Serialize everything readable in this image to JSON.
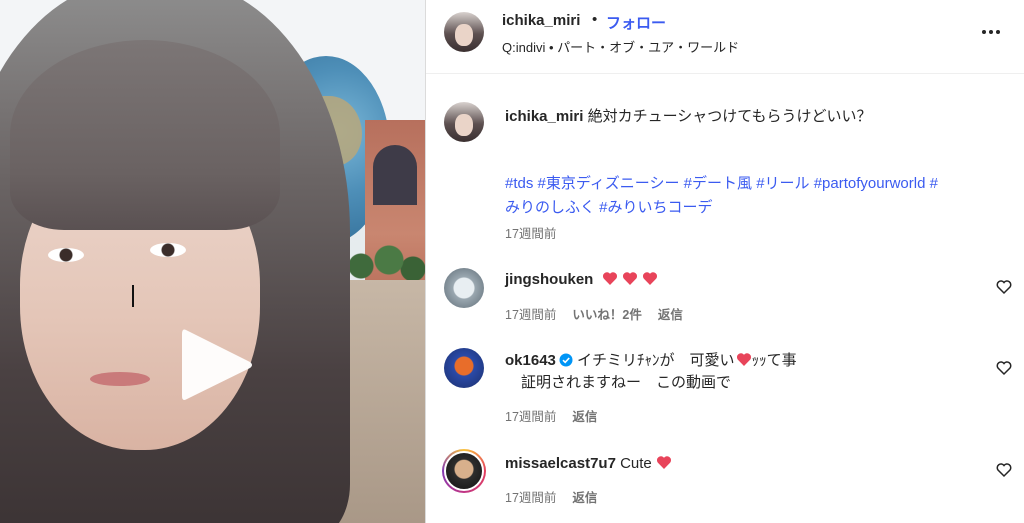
{
  "header": {
    "username": "ichika_miri",
    "dot": "•",
    "follow_label": "フォロー",
    "subtitle": "Q:indivi • パート・オブ・ユア・ワールド",
    "more_icon": "more-horizontal-icon"
  },
  "caption": {
    "username": "ichika_miri",
    "text": "絶対カチューシャつけてもらうけどいい？",
    "tags_line1": "#tds #東京ディズニーシー #デート風 #リール #partofyourworld #",
    "tags_line2": "みりのしふく #みりいちコーデ",
    "time": "17週間前"
  },
  "comments": [
    {
      "username": "jingshouken",
      "text": "",
      "time": "17週間前",
      "likes": "いいね！2件",
      "reply": "返信"
    },
    {
      "username": "ok1643",
      "text_line1": "イチミリﾁｬﾝが　可愛い",
      "text_line1_suffix": "ｯｯて事",
      "text_line2": "証明されますねー　この動画で",
      "time": "17週間前",
      "reply": "返信"
    },
    {
      "username": "missaelcast7u7",
      "text": "Cute",
      "time": "17週間前",
      "reply": "返信"
    }
  ],
  "colors": {
    "accent": "#3b5bf0",
    "heart": "#e8445a",
    "muted": "#737373",
    "verified": "#0095f6"
  }
}
